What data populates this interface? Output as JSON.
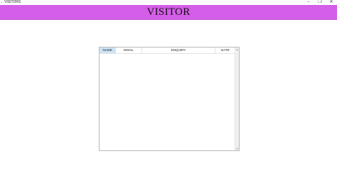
{
  "window": {
    "title": "VISITORS",
    "app_icon": "feather-icon",
    "controls": {
      "minimize": "–",
      "maximize": "❐",
      "close": "✕"
    }
  },
  "header": {
    "title": "VISITOR",
    "background": "#d45ee8"
  },
  "table": {
    "columns": [
      "NAME",
      "EMAIL",
      "ENQUIRY",
      "DATE"
    ],
    "selected_column": "NAME",
    "rows": [],
    "scroll_up": "▲",
    "scroll_down": "▼"
  }
}
